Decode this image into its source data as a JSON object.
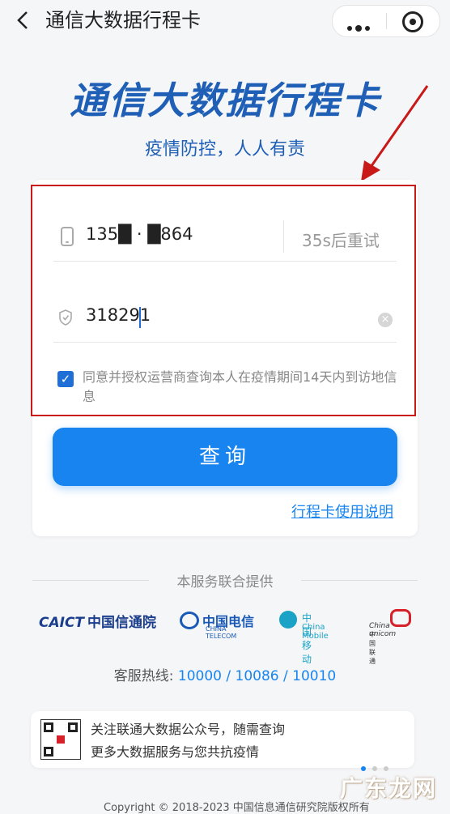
{
  "nav": {
    "title": "通信大数据行程卡"
  },
  "header": {
    "title": "通信大数据行程卡",
    "subtitle": "疫情防控，人人有责"
  },
  "form": {
    "phone_value": "135█ · █864",
    "retry_label": "35s后重试",
    "code_value": "318291",
    "consent_text": "同意并授权运营商查询本人在疫情期间14天内到访地信息",
    "consent_checked": true,
    "query_button": "查询",
    "help_link": "行程卡使用说明"
  },
  "footer": {
    "provider_title": "本服务联合提供",
    "logos": {
      "caict_en": "CAICT",
      "caict_cn": "中国信通院",
      "telecom_cn": "中国电信",
      "telecom_en": "CHINA TELECOM",
      "mobile_cn": "中国移动",
      "mobile_en": "China Mobile",
      "unicom_en": "China unicom",
      "unicom_cn": "中国联通"
    },
    "hotline_label": "客服热线:",
    "hotline_numbers": "10000 / 10086 / 10010",
    "promo_line1": "关注联通大数据公众号，随需查询",
    "promo_line2": "更多大数据服务与您共抗疫情",
    "copyright": "Copyright © 2018-2023 中国信息通信研究院版权所有"
  },
  "watermark": "广东龙网",
  "colors": {
    "brand_blue": "#1f5fb6",
    "button_blue": "#1784f0",
    "highlight_red": "#c81818"
  }
}
